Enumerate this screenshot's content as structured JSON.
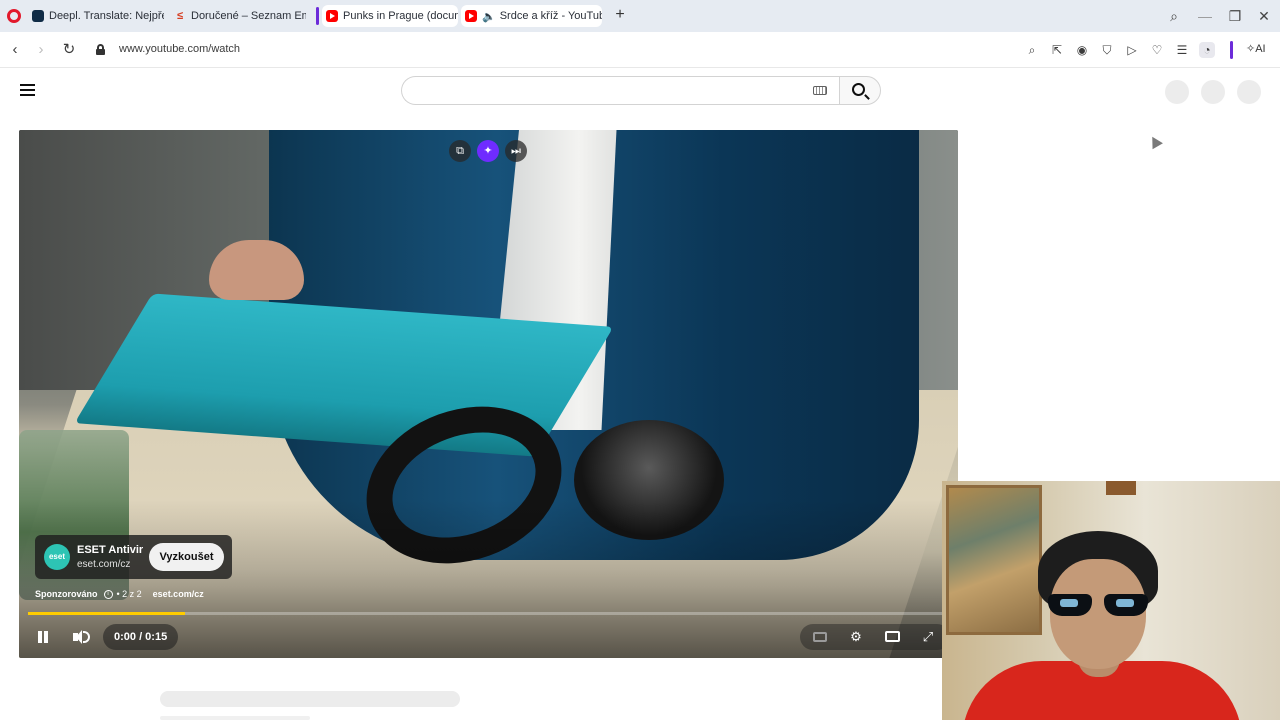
{
  "browser": {
    "tabs": [
      {
        "title": "Deepl. Translate: Nejpřesn",
        "favicon": "deepl-icon",
        "active": false
      },
      {
        "title": "Doručené – Seznam Email",
        "favicon": "seznam-icon",
        "active": false
      },
      {
        "title": "Punks in Prague (documer",
        "favicon": "youtube-icon",
        "active": true
      },
      {
        "title": "Srdce a kříž - YouTube",
        "favicon": "youtube-icon",
        "active": true,
        "audio": true
      }
    ],
    "new_tab": "+",
    "window_controls": {
      "search": "⌕",
      "minimize": "—",
      "restore": "❐",
      "close": "✕"
    },
    "nav": {
      "back": "‹",
      "forward": "›",
      "reload": "↻"
    },
    "url": "www.youtube.com/watch",
    "toolbar_icons": [
      "find-icon",
      "share-icon",
      "camera-icon",
      "shield-icon",
      "play-icon",
      "heart-icon",
      "easy-setup-icon",
      "profile-icon"
    ],
    "ai_label": "AI",
    "accent_color": "#6c2bd9"
  },
  "youtube": {
    "search": {
      "value": "",
      "placeholder": ""
    },
    "player": {
      "pip_tools": {
        "popout": "⧉",
        "ai": "✦",
        "skip": "⏭"
      },
      "ad": {
        "title": "ESET Antivir",
        "domain": "eset.com/cz",
        "logo_text": "eset",
        "cta": "Vyzkoušet",
        "sponsored_label": "Sponzorováno",
        "ad_count": "• 2 z 2",
        "sponsor_domain": "eset.com/cz"
      },
      "time": "0:00 / 0:15",
      "progress": 0.17,
      "progress_color": "#ffcc00",
      "controls": {
        "settings": "⚙",
        "fullscreen": "⤢"
      }
    }
  }
}
